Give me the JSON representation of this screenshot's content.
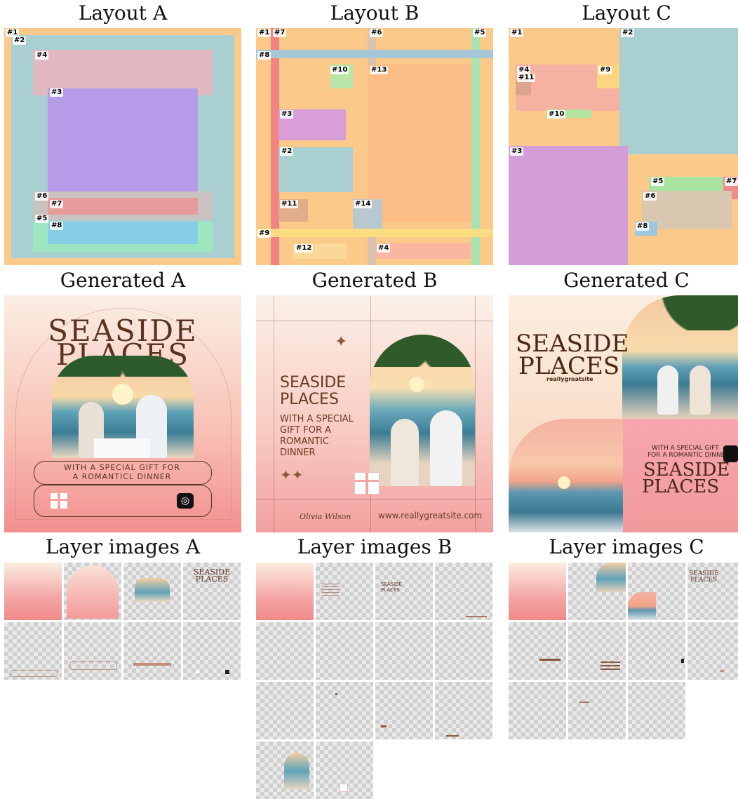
{
  "titles": {
    "layout_a": "Layout A",
    "layout_b": "Layout B",
    "layout_c": "Layout C",
    "gen_a": "Generated A",
    "gen_b": "Generated B",
    "gen_c": "Generated C",
    "layer_a": "Layer images A",
    "layer_b": "Layer images B",
    "layer_c": "Layer images C"
  },
  "layout_a": {
    "tags": [
      "#1",
      "#2",
      "#4",
      "#3",
      "#6",
      "#7",
      "#5",
      "#8"
    ]
  },
  "layout_b": {
    "tags": [
      "#1",
      "#7",
      "#6",
      "#5",
      "#8",
      "#10",
      "#13",
      "#3",
      "#2",
      "#11",
      "#14",
      "#9",
      "#12",
      "#4"
    ]
  },
  "layout_c": {
    "tags": [
      "#1",
      "#2",
      "#4",
      "#11",
      "#9",
      "#10",
      "#3",
      "#5",
      "#7",
      "#6",
      "#8"
    ]
  },
  "gen_a": {
    "headline_1": "SEASIDE",
    "headline_2": "PLACES",
    "sub_1": "WITH A SPECIAL GIFT FOR",
    "sub_2": "A ROMANTICL DINNER"
  },
  "gen_b": {
    "headline_1": "SEASIDE",
    "headline_2": "PLACES",
    "body_1": "WITH A SPECIAL",
    "body_2": "GIFT FOR A",
    "body_3": "ROMANTIC",
    "body_4": "DINNER",
    "signature": "Olivia Wilson",
    "url": "www.reallygreatsite.com"
  },
  "gen_c": {
    "headline_1": "SEASIDE",
    "headline_2": "PLACES",
    "site": "reallygreatsite",
    "sub_1": "WITH A SPECIAL GIFT",
    "sub_2": "FOR A ROMANTIC DINNER",
    "headline2_1": "SEASIDE",
    "headline2_2": "PLACES"
  },
  "layer_a": {
    "headline_1": "SEASIDE",
    "headline_2": "PLACES"
  },
  "layer_b": {
    "headline_1": "SEASIDE",
    "headline_2": "PLACES"
  },
  "layer_c": {
    "headline_1": "SEASIDE",
    "headline_2": "PLACES"
  },
  "colors": {
    "orange": "#fbc98a",
    "teal": "#a9cfd0",
    "pink": "#f3b0b0",
    "purple": "#b08ee8",
    "red": "#f28383",
    "blue": "#7ec8ec",
    "green": "#9ee6a8",
    "brown_text": "#5a3320"
  }
}
